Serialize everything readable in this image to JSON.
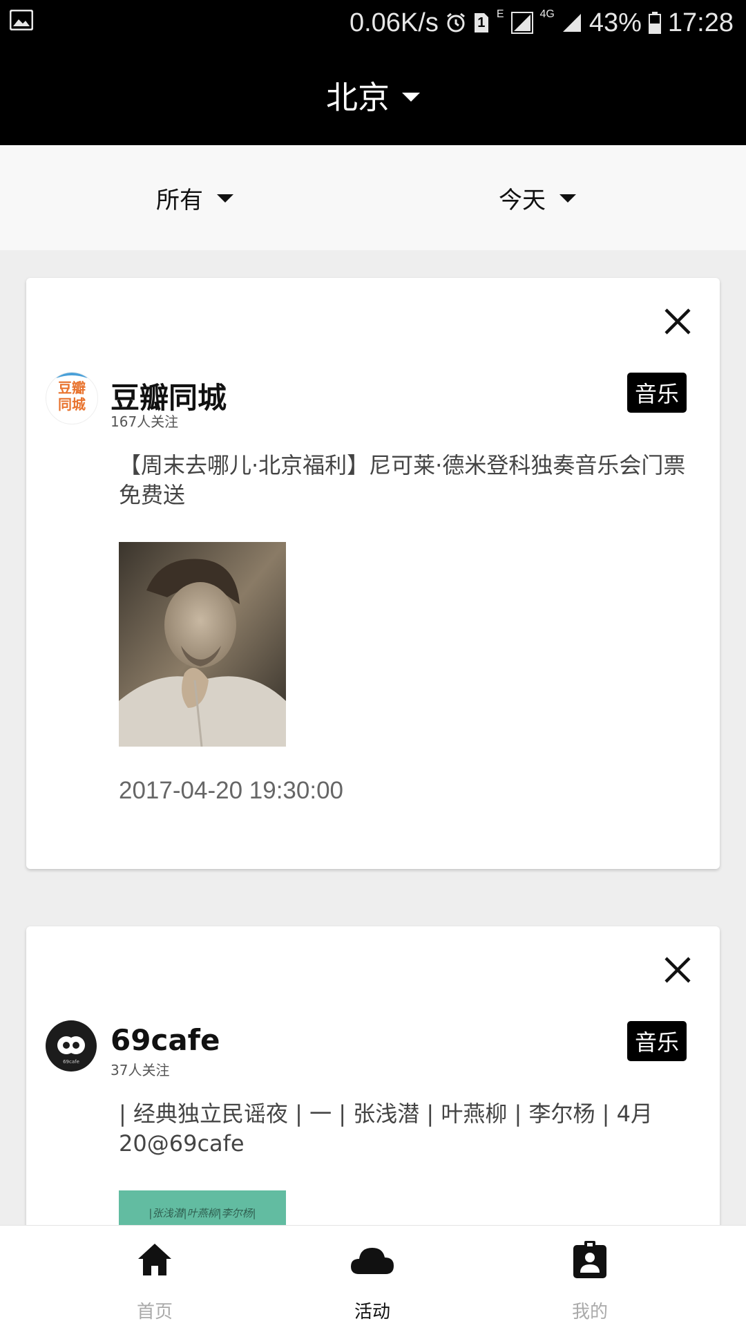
{
  "status_bar": {
    "net_speed": "0.06K/s",
    "sim_badge": "1",
    "network_e": "E",
    "network_4g": "4G",
    "battery": "43%",
    "time": "17:28",
    "icons": [
      "image-icon",
      "alarm-icon",
      "sim-icon",
      "signal-icon",
      "battery-icon"
    ]
  },
  "header": {
    "city": "北京"
  },
  "filters": {
    "category": "所有",
    "date": "今天"
  },
  "feed": [
    {
      "org_name": "豆瓣同城",
      "avatar_text_line1": "豆瓣",
      "avatar_text_line2": "同城",
      "followers": "167人关注",
      "tag": "音乐",
      "title": "【周末去哪儿·北京福利】尼可莱·德米登科独奏音乐会门票免费送",
      "time": "2017-04-20 19:30:00"
    },
    {
      "org_name": "69cafe",
      "avatar_caption": "69cafe",
      "followers": "37人关注",
      "tag": "音乐",
      "title": "| 经典独立民谣夜 | 一 | 张浅潜 | 叶燕柳 | 李尔杨 | 4月20@69cafe",
      "poster_text": "|张浅潜|叶燕柳|李尔杨|"
    }
  ],
  "bottom_nav": [
    {
      "label": "首页",
      "icon": "home-icon",
      "active": false
    },
    {
      "label": "活动",
      "icon": "cloud-icon",
      "active": true
    },
    {
      "label": "我的",
      "icon": "profile-badge-icon",
      "active": false
    }
  ],
  "colors": {
    "header_bg": "#000000",
    "active_nav": "#111111",
    "inactive_nav": "#aaaaaa",
    "page_bg": "#eeeeee",
    "tag_bg": "#000000",
    "douban_orange": "#e8732e",
    "poster_teal": "#62bca1"
  }
}
